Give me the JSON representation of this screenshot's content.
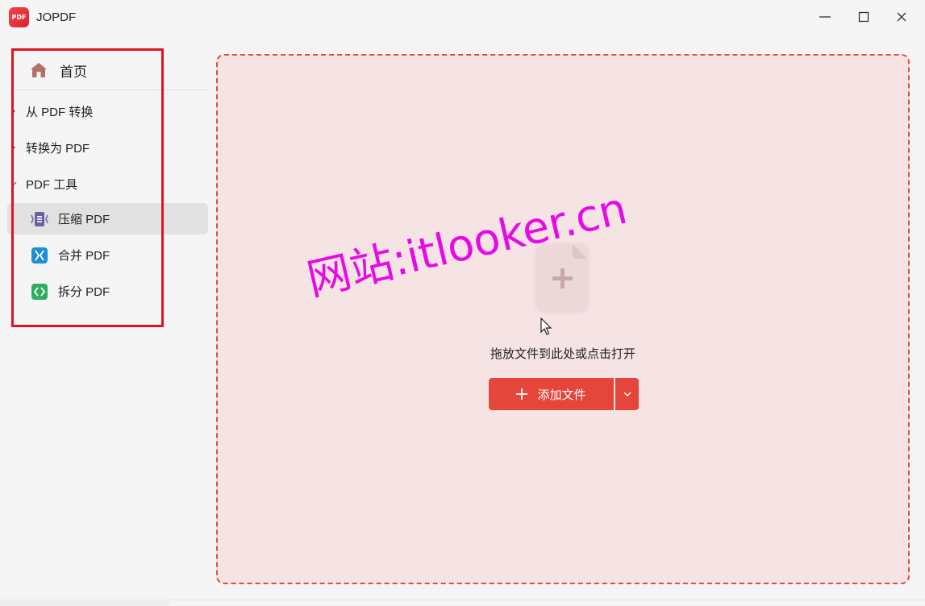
{
  "app": {
    "title": "JOPDF",
    "logo_text": "PDF"
  },
  "window_controls": {
    "minimize_icon": "minimize-icon",
    "maximize_icon": "maximize-icon",
    "close_icon": "close-icon"
  },
  "sidebar": {
    "home": {
      "label": "首页",
      "icon": "home-icon"
    },
    "groups": [
      {
        "label": "从 PDF 转换",
        "expanded": false
      },
      {
        "label": "转换为 PDF",
        "expanded": false
      },
      {
        "label": "PDF 工具",
        "expanded": true
      }
    ],
    "tools": [
      {
        "label": "压缩 PDF",
        "icon": "compress-icon",
        "active": true
      },
      {
        "label": "合并 PDF",
        "icon": "merge-icon",
        "active": false
      },
      {
        "label": "拆分 PDF",
        "icon": "split-icon",
        "active": false
      }
    ]
  },
  "dropzone": {
    "hint": "拖放文件到此处或点击打开",
    "add_button_label": "添加文件",
    "add_button_icon": "plus-icon",
    "dropdown_icon": "chevron-down-icon"
  },
  "watermark": "网站:itlooker.cn",
  "colors": {
    "accent": "#e5463b",
    "dropzone_bg": "#f6e3e4",
    "highlight_box": "#e0141e",
    "watermark": "#e60ae6"
  }
}
